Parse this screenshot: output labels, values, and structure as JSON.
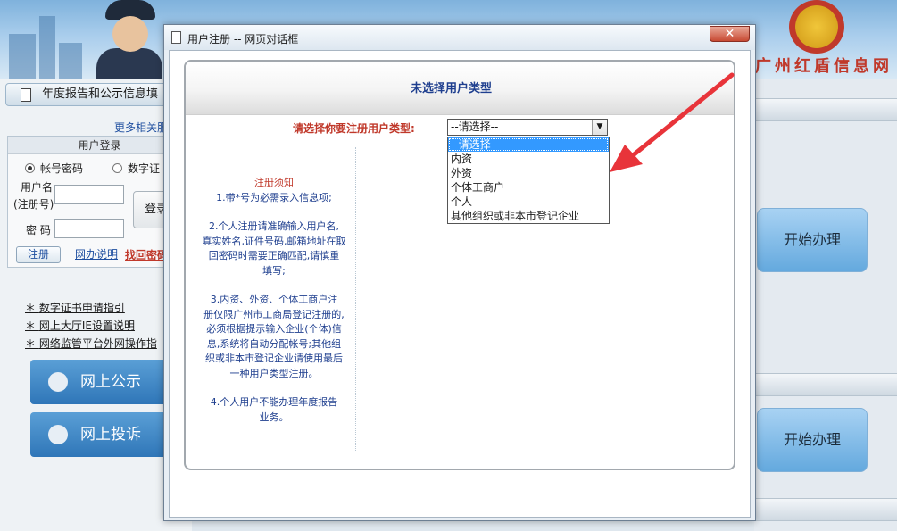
{
  "background": {
    "banner": {
      "site_name": "广州红盾信息网",
      "emblem_icon": "national-emblem-icon"
    },
    "sidebar": {
      "title": "年度报告和公示信息填",
      "more_link": "更多相关服",
      "login": {
        "header": "用户登录",
        "radio_account": "帐号密码",
        "radio_cert": "数字证",
        "username_label_1": "用户名",
        "username_label_2": "(注册号)",
        "password_label": "密  码",
        "login_button": "登录",
        "register_button": "注册",
        "help_link": "网办说明",
        "find_password_link": "找回密码"
      },
      "links": [
        "数字证书申请指引",
        "网上大厅IE设置说明",
        "网络监管平台外网操作指"
      ],
      "big_buttons": [
        "网上公示",
        "网上投诉"
      ]
    },
    "right_panel": {
      "start_buttons": [
        "开始办理",
        "开始办理"
      ]
    }
  },
  "dialog": {
    "title": "用户注册 -- 网页对话框",
    "close_label": "✕",
    "header_title": "未选择用户类型",
    "type_label": "请选择你要注册用户类型:",
    "select": {
      "value": "--请选择--",
      "options": [
        "--请选择--",
        "内资",
        "外资",
        "个体工商户",
        "个人",
        "其他组织或非本市登记企业"
      ],
      "selected_index": 0
    },
    "notice": {
      "title": "注册须知",
      "items": [
        [
          "1.带*号为必需录入信息项;"
        ],
        [
          "2.个人注册请准确输入用户名,",
          "真实姓名,证件号码,邮箱地址在取",
          "回密码时需要正确匹配,请慎重",
          "填写;"
        ],
        [
          "3.内资、外资、个体工商户注",
          "册仅限广州市工商局登记注册的,",
          "必须根据提示输入企业(个体)信",
          "息,系统将自动分配帐号;其他组",
          "织或非本市登记企业请使用最后",
          "一种用户类型注册。"
        ],
        [
          "4.个人用户不能办理年度报告",
          "业务。"
        ]
      ]
    }
  },
  "colors": {
    "annotation_arrow": "#e8343a",
    "accent_blue": "#1f3f8f",
    "alert_red": "#c0392b",
    "selection": "#3399ff"
  }
}
